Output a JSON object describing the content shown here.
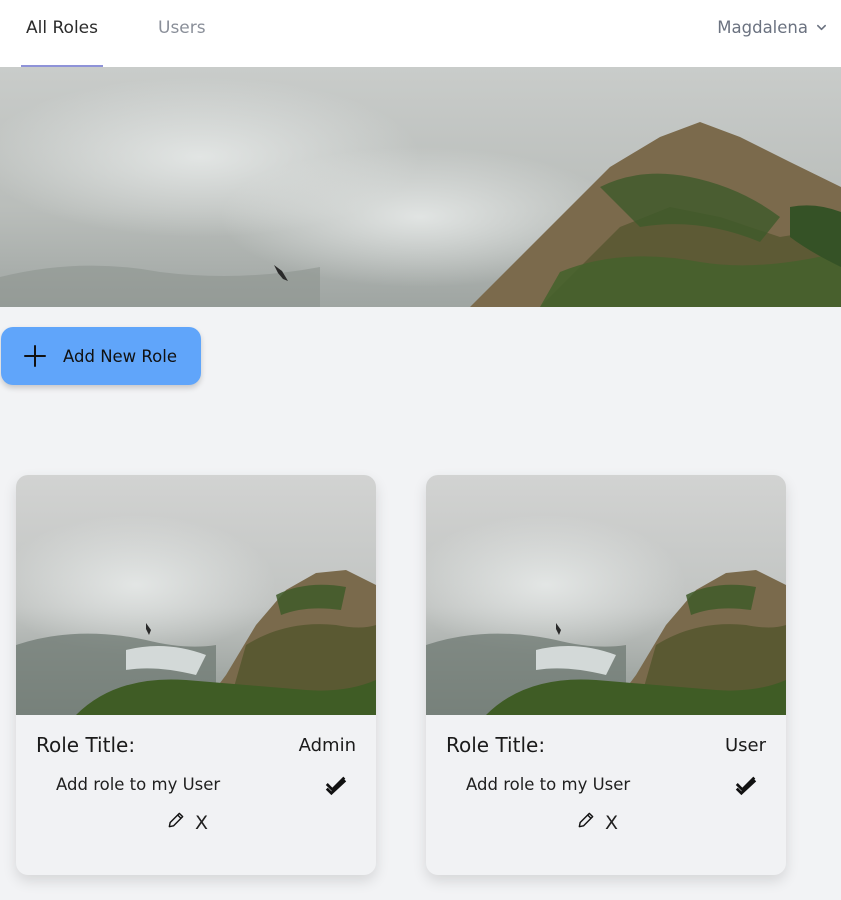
{
  "nav": {
    "tabs": [
      {
        "label": "All Roles",
        "active": true
      },
      {
        "label": "Users",
        "active": false
      }
    ],
    "user_menu": {
      "name": "Magdalena",
      "icon": "chevron-down-icon"
    }
  },
  "hero": {
    "image": "foggy-mountain-cliff-with-bird"
  },
  "actions": {
    "add_role_label": "Add New Role",
    "add_icon": "plus-icon"
  },
  "roles": [
    {
      "title_label": "Role Title:",
      "title_value": "Admin",
      "add_text": "Add role to my User",
      "check_icon": "double-check-icon",
      "edit_icon": "pencil-icon",
      "delete_label": "X"
    },
    {
      "title_label": "Role Title:",
      "title_value": "User",
      "add_text": "Add role to my User",
      "check_icon": "double-check-icon",
      "edit_icon": "pencil-icon",
      "delete_label": "X"
    }
  ],
  "colors": {
    "accent_button": "#60a5fa",
    "active_tab_underline": "#8f93d8",
    "page_background": "#f2f3f5"
  }
}
